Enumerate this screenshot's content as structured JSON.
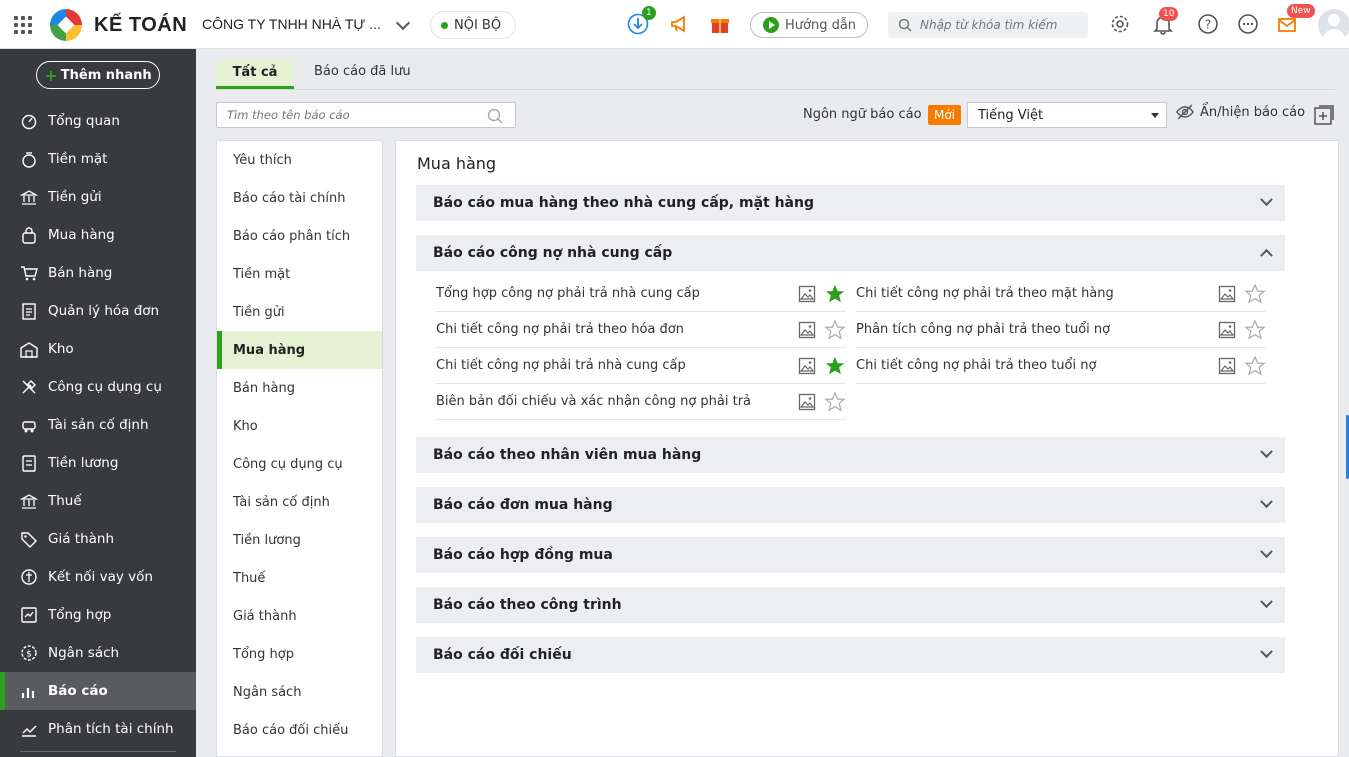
{
  "header": {
    "brand": "KẾ TOÁN",
    "company": "CÔNG TY TNHH NHÀ TỰ ...",
    "scope_chip": "NỘI BỘ",
    "download_badge": "1",
    "guide_label": "Hướng dẫn",
    "search_placeholder": "Nhập từ khóa tìm kiếm",
    "notification_badge": "10",
    "news_badge": "New"
  },
  "sidebar": {
    "add_button": "Thêm nhanh",
    "items": [
      {
        "label": "Tổng quan",
        "icon": "dashboard-icon"
      },
      {
        "label": "Tiền mặt",
        "icon": "cash-icon"
      },
      {
        "label": "Tiền gửi",
        "icon": "bank-icon"
      },
      {
        "label": "Mua hàng",
        "icon": "purchase-bag-icon"
      },
      {
        "label": "Bán hàng",
        "icon": "cart-icon"
      },
      {
        "label": "Quản lý hóa đơn",
        "icon": "invoice-icon"
      },
      {
        "label": "Kho",
        "icon": "warehouse-icon"
      },
      {
        "label": "Công cụ dụng cụ",
        "icon": "tools-icon"
      },
      {
        "label": "Tài sản cố định",
        "icon": "asset-icon"
      },
      {
        "label": "Tiền lương",
        "icon": "salary-icon"
      },
      {
        "label": "Thuế",
        "icon": "tax-icon"
      },
      {
        "label": "Giá thành",
        "icon": "price-tag-icon"
      },
      {
        "label": "Kết nối vay vốn",
        "icon": "loan-icon"
      },
      {
        "label": "Tổng hợp",
        "icon": "summary-icon"
      },
      {
        "label": "Ngân sách",
        "icon": "budget-icon"
      },
      {
        "label": "Báo cáo",
        "icon": "report-chart-icon"
      },
      {
        "label": "Phân tích tài chính",
        "icon": "analysis-icon"
      }
    ],
    "active_index": 15
  },
  "tabs": {
    "all": "Tất cả",
    "saved": "Báo cáo đã lưu"
  },
  "filter": {
    "placeholder": "Tìm theo tên báo cáo"
  },
  "language": {
    "label": "Ngôn ngữ báo cáo",
    "new_badge": "Mới",
    "selected": "Tiếng Việt"
  },
  "toggle_reports_label": "Ẩn/hiện báo cáo",
  "categories": [
    "Yêu thích",
    "Báo cáo tài chính",
    "Báo cáo phân tích",
    "Tiền mặt",
    "Tiền gửi",
    "Mua hàng",
    "Bán hàng",
    "Kho",
    "Công cụ dụng cụ",
    "Tài sản cố định",
    "Tiền lương",
    "Thuế",
    "Giá thành",
    "Tổng hợp",
    "Ngân sách",
    "Báo cáo đối chiếu"
  ],
  "active_category_index": 5,
  "main": {
    "title": "Mua hàng",
    "groups": [
      {
        "label": "Báo cáo mua hàng theo nhà cung cấp, mặt hàng",
        "expanded": false
      },
      {
        "label": "Báo cáo công nợ nhà cung cấp",
        "expanded": true
      },
      {
        "label": "Báo cáo theo nhân viên mua hàng",
        "expanded": false
      },
      {
        "label": "Báo cáo đơn mua hàng",
        "expanded": false
      },
      {
        "label": "Báo cáo hợp đồng mua",
        "expanded": false
      },
      {
        "label": "Báo cáo theo công trình",
        "expanded": false
      },
      {
        "label": "Báo cáo đối chiếu",
        "expanded": false
      }
    ],
    "reports": [
      {
        "label": "Tổng hợp công nợ phải trả nhà cung cấp",
        "favorite": true
      },
      {
        "label": "Chi tiết công nợ phải trả theo mặt hàng",
        "favorite": false
      },
      {
        "label": "Chi tiết công nợ phải trả theo hóa đơn",
        "favorite": false
      },
      {
        "label": "Phân tích công nợ phải trả theo tuổi nợ",
        "favorite": false
      },
      {
        "label": "Chi tiết công nợ phải trả nhà cung cấp",
        "favorite": true
      },
      {
        "label": "Chi tiết công nợ phải trả theo tuổi nợ",
        "favorite": false
      },
      {
        "label": "Biên bản đối chiếu và xác nhận công nợ phải trả",
        "favorite": false
      }
    ]
  },
  "colors": {
    "accent": "#2ca01c",
    "sidebar_bg": "#393a3d",
    "star_favorite": "#2ca01c",
    "new_badge": "#f57c00"
  }
}
